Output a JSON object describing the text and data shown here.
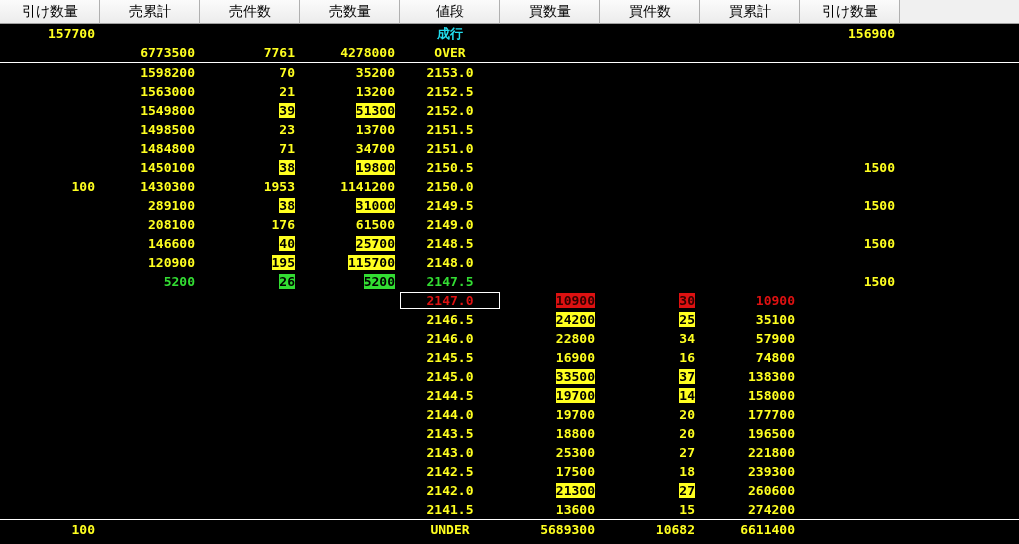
{
  "columns": [
    "引け数量",
    "売累計",
    "売件数",
    "売数量",
    "値段",
    "買数量",
    "買件数",
    "買累計",
    "引け数量"
  ],
  "rows": [
    {
      "kind": "market",
      "selected": false,
      "close_sell": {
        "text": "157700",
        "flagged": false
      },
      "price": {
        "text": "成行",
        "flagged": false
      },
      "close_buy": {
        "text": "156900",
        "flagged": false
      }
    },
    {
      "kind": "over",
      "selected": false,
      "sell_total": {
        "text": "6773500",
        "flagged": false
      },
      "sell_orders": {
        "text": "7761",
        "flagged": false
      },
      "sell_qty": {
        "text": "4278000",
        "flagged": false
      },
      "price": {
        "text": "OVER",
        "flagged": false
      }
    },
    {
      "kind": "ask",
      "selected": false,
      "sell_total": {
        "text": "1598200",
        "flagged": false
      },
      "sell_orders": {
        "text": "70",
        "flagged": false
      },
      "sell_qty": {
        "text": "35200",
        "flagged": false
      },
      "price": {
        "text": "2153.0",
        "flagged": false
      }
    },
    {
      "kind": "ask",
      "selected": false,
      "sell_total": {
        "text": "1563000",
        "flagged": false
      },
      "sell_orders": {
        "text": "21",
        "flagged": false
      },
      "sell_qty": {
        "text": "13200",
        "flagged": false
      },
      "price": {
        "text": "2152.5",
        "flagged": false
      }
    },
    {
      "kind": "ask",
      "selected": false,
      "sell_total": {
        "text": "1549800",
        "flagged": false
      },
      "sell_orders": {
        "text": "39",
        "flagged": true
      },
      "sell_qty": {
        "text": "51300",
        "flagged": true
      },
      "price": {
        "text": "2152.0",
        "flagged": false
      }
    },
    {
      "kind": "ask",
      "selected": false,
      "sell_total": {
        "text": "1498500",
        "flagged": false
      },
      "sell_orders": {
        "text": "23",
        "flagged": false
      },
      "sell_qty": {
        "text": "13700",
        "flagged": false
      },
      "price": {
        "text": "2151.5",
        "flagged": false
      }
    },
    {
      "kind": "ask",
      "selected": false,
      "sell_total": {
        "text": "1484800",
        "flagged": false
      },
      "sell_orders": {
        "text": "71",
        "flagged": false
      },
      "sell_qty": {
        "text": "34700",
        "flagged": false
      },
      "price": {
        "text": "2151.0",
        "flagged": false
      }
    },
    {
      "kind": "ask",
      "selected": false,
      "sell_total": {
        "text": "1450100",
        "flagged": false
      },
      "sell_orders": {
        "text": "38",
        "flagged": true
      },
      "sell_qty": {
        "text": "19800",
        "flagged": true
      },
      "price": {
        "text": "2150.5",
        "flagged": false
      },
      "close_buy": {
        "text": "1500",
        "flagged": false
      }
    },
    {
      "kind": "ask",
      "selected": false,
      "close_sell": {
        "text": "100",
        "flagged": false
      },
      "sell_total": {
        "text": "1430300",
        "flagged": false
      },
      "sell_orders": {
        "text": "1953",
        "flagged": false
      },
      "sell_qty": {
        "text": "1141200",
        "flagged": false
      },
      "price": {
        "text": "2150.0",
        "flagged": false
      }
    },
    {
      "kind": "ask",
      "selected": false,
      "sell_total": {
        "text": "289100",
        "flagged": false
      },
      "sell_orders": {
        "text": "38",
        "flagged": true
      },
      "sell_qty": {
        "text": "31000",
        "flagged": true
      },
      "price": {
        "text": "2149.5",
        "flagged": false
      },
      "close_buy": {
        "text": "1500",
        "flagged": false
      }
    },
    {
      "kind": "ask",
      "selected": false,
      "sell_total": {
        "text": "208100",
        "flagged": false
      },
      "sell_orders": {
        "text": "176",
        "flagged": false
      },
      "sell_qty": {
        "text": "61500",
        "flagged": false
      },
      "price": {
        "text": "2149.0",
        "flagged": false
      }
    },
    {
      "kind": "ask",
      "selected": false,
      "sell_total": {
        "text": "146600",
        "flagged": false
      },
      "sell_orders": {
        "text": "40",
        "flagged": true
      },
      "sell_qty": {
        "text": "25700",
        "flagged": true
      },
      "price": {
        "text": "2148.5",
        "flagged": false
      },
      "close_buy": {
        "text": "1500",
        "flagged": false
      }
    },
    {
      "kind": "ask",
      "selected": false,
      "sell_total": {
        "text": "120900",
        "flagged": false
      },
      "sell_orders": {
        "text": "195",
        "flagged": true
      },
      "sell_qty": {
        "text": "115700",
        "flagged": true
      },
      "price": {
        "text": "2148.0",
        "flagged": false
      }
    },
    {
      "kind": "best_ask",
      "selected": false,
      "sell_total": {
        "text": "5200",
        "flagged": false
      },
      "sell_orders": {
        "text": "26",
        "flagged": true
      },
      "sell_qty": {
        "text": "5200",
        "flagged": true
      },
      "price": {
        "text": "2147.5",
        "flagged": false
      },
      "close_buy": {
        "text": "1500",
        "flagged": false
      }
    },
    {
      "kind": "best_bid",
      "selected": true,
      "price": {
        "text": "2147.0",
        "flagged": false
      },
      "buy_qty": {
        "text": "10900",
        "flagged": true
      },
      "buy_orders": {
        "text": "30",
        "flagged": true
      },
      "buy_total": {
        "text": "10900",
        "flagged": false
      }
    },
    {
      "kind": "bid",
      "selected": false,
      "price": {
        "text": "2146.5",
        "flagged": false
      },
      "buy_qty": {
        "text": "24200",
        "flagged": true
      },
      "buy_orders": {
        "text": "25",
        "flagged": true
      },
      "buy_total": {
        "text": "35100",
        "flagged": false
      }
    },
    {
      "kind": "bid",
      "selected": false,
      "price": {
        "text": "2146.0",
        "flagged": false
      },
      "buy_qty": {
        "text": "22800",
        "flagged": false
      },
      "buy_orders": {
        "text": "34",
        "flagged": false
      },
      "buy_total": {
        "text": "57900",
        "flagged": false
      }
    },
    {
      "kind": "bid",
      "selected": false,
      "price": {
        "text": "2145.5",
        "flagged": false
      },
      "buy_qty": {
        "text": "16900",
        "flagged": false
      },
      "buy_orders": {
        "text": "16",
        "flagged": false
      },
      "buy_total": {
        "text": "74800",
        "flagged": false
      }
    },
    {
      "kind": "bid",
      "selected": false,
      "price": {
        "text": "2145.0",
        "flagged": false
      },
      "buy_qty": {
        "text": "33500",
        "flagged": true
      },
      "buy_orders": {
        "text": "37",
        "flagged": true
      },
      "buy_total": {
        "text": "138300",
        "flagged": false
      }
    },
    {
      "kind": "bid",
      "selected": false,
      "price": {
        "text": "2144.5",
        "flagged": false
      },
      "buy_qty": {
        "text": "19700",
        "flagged": true
      },
      "buy_orders": {
        "text": "14",
        "flagged": true
      },
      "buy_total": {
        "text": "158000",
        "flagged": false
      }
    },
    {
      "kind": "bid",
      "selected": false,
      "price": {
        "text": "2144.0",
        "flagged": false
      },
      "buy_qty": {
        "text": "19700",
        "flagged": false
      },
      "buy_orders": {
        "text": "20",
        "flagged": false
      },
      "buy_total": {
        "text": "177700",
        "flagged": false
      }
    },
    {
      "kind": "bid",
      "selected": false,
      "price": {
        "text": "2143.5",
        "flagged": false
      },
      "buy_qty": {
        "text": "18800",
        "flagged": false
      },
      "buy_orders": {
        "text": "20",
        "flagged": false
      },
      "buy_total": {
        "text": "196500",
        "flagged": false
      }
    },
    {
      "kind": "bid",
      "selected": false,
      "price": {
        "text": "2143.0",
        "flagged": false
      },
      "buy_qty": {
        "text": "25300",
        "flagged": false
      },
      "buy_orders": {
        "text": "27",
        "flagged": false
      },
      "buy_total": {
        "text": "221800",
        "flagged": false
      }
    },
    {
      "kind": "bid",
      "selected": false,
      "price": {
        "text": "2142.5",
        "flagged": false
      },
      "buy_qty": {
        "text": "17500",
        "flagged": false
      },
      "buy_orders": {
        "text": "18",
        "flagged": false
      },
      "buy_total": {
        "text": "239300",
        "flagged": false
      }
    },
    {
      "kind": "bid",
      "selected": false,
      "price": {
        "text": "2142.0",
        "flagged": false
      },
      "buy_qty": {
        "text": "21300",
        "flagged": true
      },
      "buy_orders": {
        "text": "27",
        "flagged": true
      },
      "buy_total": {
        "text": "260600",
        "flagged": false
      }
    },
    {
      "kind": "bid",
      "selected": false,
      "price": {
        "text": "2141.5",
        "flagged": false
      },
      "buy_qty": {
        "text": "13600",
        "flagged": false
      },
      "buy_orders": {
        "text": "15",
        "flagged": false
      },
      "buy_total": {
        "text": "274200",
        "flagged": false
      }
    },
    {
      "kind": "under",
      "selected": false,
      "close_sell": {
        "text": "100",
        "flagged": false
      },
      "price": {
        "text": "UNDER",
        "flagged": false
      },
      "buy_qty": {
        "text": "5689300",
        "flagged": false
      },
      "buy_orders": {
        "text": "10682",
        "flagged": false
      },
      "buy_total": {
        "text": "6611400",
        "flagged": false
      }
    }
  ]
}
